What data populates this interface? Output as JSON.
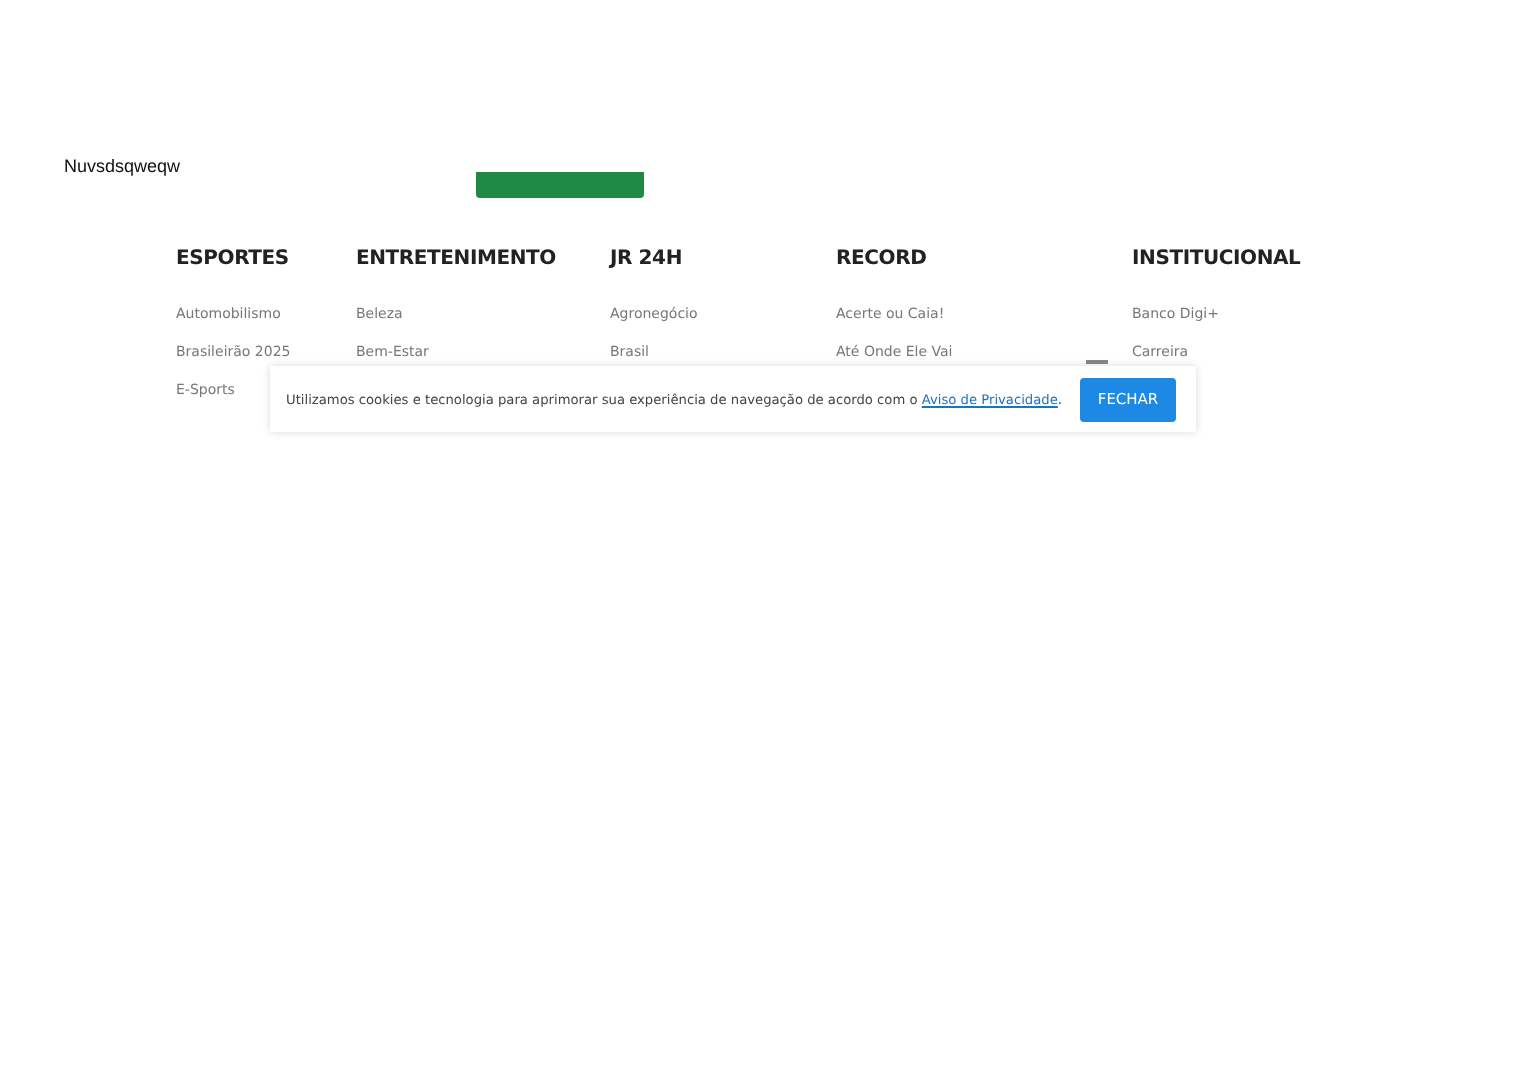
{
  "page": {
    "title": "Nuvsdsqweqw"
  },
  "footer": {
    "columns": [
      {
        "heading": "ESPORTES",
        "links": [
          "Automobilismo",
          "Brasileirão 2025",
          "E-Sports"
        ]
      },
      {
        "heading": "ENTRETENIMENTO",
        "links": [
          "Beleza",
          "Bem-Estar"
        ]
      },
      {
        "heading": "JR 24H",
        "links": [
          "Agronegócio",
          "Brasil"
        ]
      },
      {
        "heading": "RECORD",
        "links": [
          "Acerte ou Caia!",
          "Até Onde Ele Vai"
        ]
      },
      {
        "heading": "INSTITUCIONAL",
        "links": [
          "Banco Digi+",
          "Carreira"
        ]
      }
    ]
  },
  "cookie_banner": {
    "text": "Utilizamos cookies e tecnologia para aprimorar sua experiência de navegação de acordo com o ",
    "link": "Aviso de Privacidade",
    "after_link": ".",
    "button": "FECHAR"
  }
}
